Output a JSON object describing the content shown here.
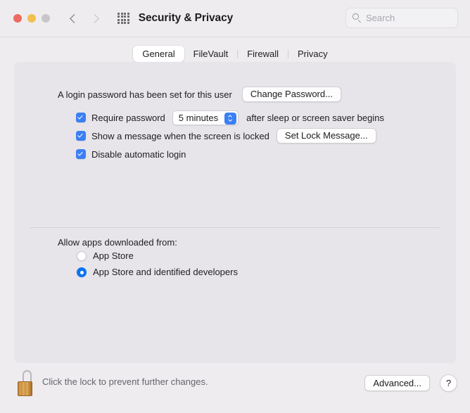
{
  "window": {
    "title": "Security & Privacy",
    "traffic_lights": {
      "close": "close-button",
      "minimize": "minimize-button",
      "zoom": "zoom-button"
    },
    "nav": {
      "back": "back-chevron-icon",
      "forward": "forward-chevron-icon",
      "grid": "show-all-grid-icon"
    },
    "search": {
      "placeholder": "Search",
      "value": "",
      "icon": "search-icon"
    }
  },
  "tabs": [
    {
      "label": "General",
      "selected": true
    },
    {
      "label": "FileVault",
      "selected": false
    },
    {
      "label": "Firewall",
      "selected": false
    },
    {
      "label": "Privacy",
      "selected": false
    }
  ],
  "general": {
    "login_password_text": "A login password has been set for this user",
    "change_password_button": "Change Password...",
    "require_password": {
      "label": "Require password",
      "checked": true,
      "delay_value": "5 minutes",
      "trailing_text": "after sleep or screen saver begins",
      "stepper_icon": "up-down-chevron-icon"
    },
    "show_message": {
      "label": "Show a message when the screen is locked",
      "checked": true,
      "button": "Set Lock Message..."
    },
    "disable_auto_login": {
      "label": "Disable automatic login",
      "checked": true
    },
    "allow_apps": {
      "title": "Allow apps downloaded from:",
      "options": [
        {
          "label": "App Store",
          "selected": false
        },
        {
          "label": "App Store and identified developers",
          "selected": true
        }
      ]
    }
  },
  "footer": {
    "lock_icon": "open-padlock-icon",
    "lock_caption": "Click the lock to prevent further changes.",
    "advanced_button": "Advanced...",
    "help_button": "?"
  },
  "colors": {
    "accent_blue": "#3b7ff5",
    "radio_blue": "#0a74f0",
    "window_bg": "#eeecef",
    "panel_bg": "#e7e5e9",
    "close_red": "#ec6a5e",
    "minimize_yellow": "#f3bf4f",
    "zoom_gray": "#c6c6c9",
    "lock_gold": "#cc9343"
  }
}
